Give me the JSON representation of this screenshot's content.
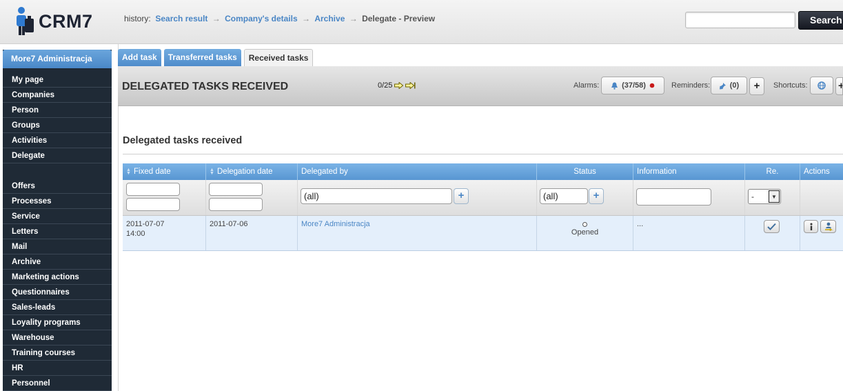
{
  "app": {
    "name": "CRM7"
  },
  "history": {
    "label": "history:",
    "crumbs": [
      "Search result",
      "Company's details",
      "Archive"
    ],
    "current": "Delegate - Preview",
    "separator": "→"
  },
  "search": {
    "button_label": "Search",
    "placeholder": ""
  },
  "sidebar": {
    "user": "More7 Administracja",
    "group1": [
      "My page",
      "Companies",
      "Person",
      "Groups",
      "Activities",
      "Delegate"
    ],
    "group2": [
      "Offers",
      "Processes",
      "Service",
      "Letters",
      "Mail",
      "Archive",
      "Marketing actions",
      "Questionnaires",
      "Sales-leads",
      "Loyality programs",
      "Warehouse",
      "Training courses",
      "HR",
      "Personnel"
    ]
  },
  "tabs": [
    "Add task",
    "Transferred tasks",
    "Received tasks"
  ],
  "toolbar": {
    "title": "DELEGATED TASKS RECEIVED",
    "pager": "0/25",
    "alarms_label": "Alarms:",
    "alarms_value": "(37/58)",
    "reminders_label": "Reminders:",
    "reminders_value": "(0)",
    "shortcuts_label": "Shortcuts:",
    "plus": "+"
  },
  "section": {
    "title": "Delegated tasks received"
  },
  "table": {
    "columns": [
      "Fixed date",
      "Delegation date",
      "Delegated by",
      "Status",
      "Information",
      "Re.",
      "Actions"
    ],
    "filters": {
      "delegated_by": "(all)",
      "status": "(all)",
      "re_select": "-"
    },
    "rows": [
      {
        "fixed_date": "2011-07-07",
        "fixed_time": "14:00",
        "delegation_date": "2011-07-06",
        "delegated_by": "More7 Administracja",
        "status": "Opened",
        "information": "..."
      }
    ]
  },
  "colors": {
    "accent": "#4a86c5",
    "sidebar_bg": "#1f2a36",
    "header_blue": "#5896d2",
    "row_bg": "#e4effb"
  },
  "icons": [
    "user-logo-icon",
    "bell-icon",
    "red-dot-icon",
    "pin-icon",
    "globe-icon",
    "check-icon",
    "info-icon",
    "person-arrow-icon",
    "sort-arrows-icon",
    "pager-arrow-icon"
  ]
}
